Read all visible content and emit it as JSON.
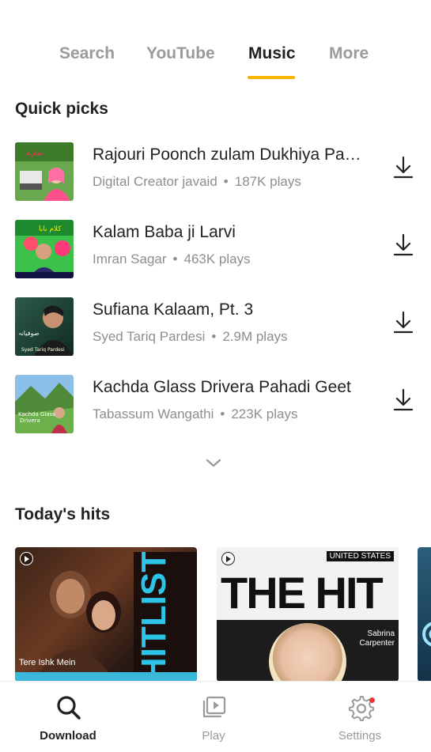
{
  "tabs": [
    {
      "label": "Search"
    },
    {
      "label": "YouTube"
    },
    {
      "label": "Music"
    },
    {
      "label": "More"
    }
  ],
  "active_tab": "Music",
  "accent_color": "#f7b500",
  "quick_picks": {
    "title": "Quick picks",
    "items": [
      {
        "title": "Rajouri Poonch zulam Dukhiya Pahari Geet",
        "artist": "Digital Creator javaid",
        "plays": "187K plays"
      },
      {
        "title": "Kalam Baba ji Larvi",
        "artist": "Imran Sagar",
        "plays": "463K plays"
      },
      {
        "title": "Sufiana Kalaam, Pt. 3",
        "artist": "Syed Tariq Pardesi",
        "plays": "2.9M plays"
      },
      {
        "title": "Kachda Glass Drivera Pahadi Geet",
        "artist": "Tabassum Wangathi",
        "plays": "223K plays"
      }
    ],
    "separator": "•",
    "action_icon": "download-icon",
    "expand_icon": "chevron-down-icon"
  },
  "todays_hits": {
    "title": "Today's hits",
    "cards": [
      {
        "caption": "Tere Ishk Mein",
        "big_text": "HITLIST"
      },
      {
        "country": "UNITED STATES",
        "big_text": "THE HIT LIST",
        "artist_line1": "Sabrina",
        "artist_line2": "Carpenter"
      }
    ]
  },
  "bottom_nav": {
    "items": [
      {
        "label": "Download",
        "icon": "search-icon",
        "active": true
      },
      {
        "label": "Play",
        "icon": "play-library-icon",
        "active": false
      },
      {
        "label": "Settings",
        "icon": "gear-icon",
        "active": false,
        "badge": true
      }
    ]
  }
}
